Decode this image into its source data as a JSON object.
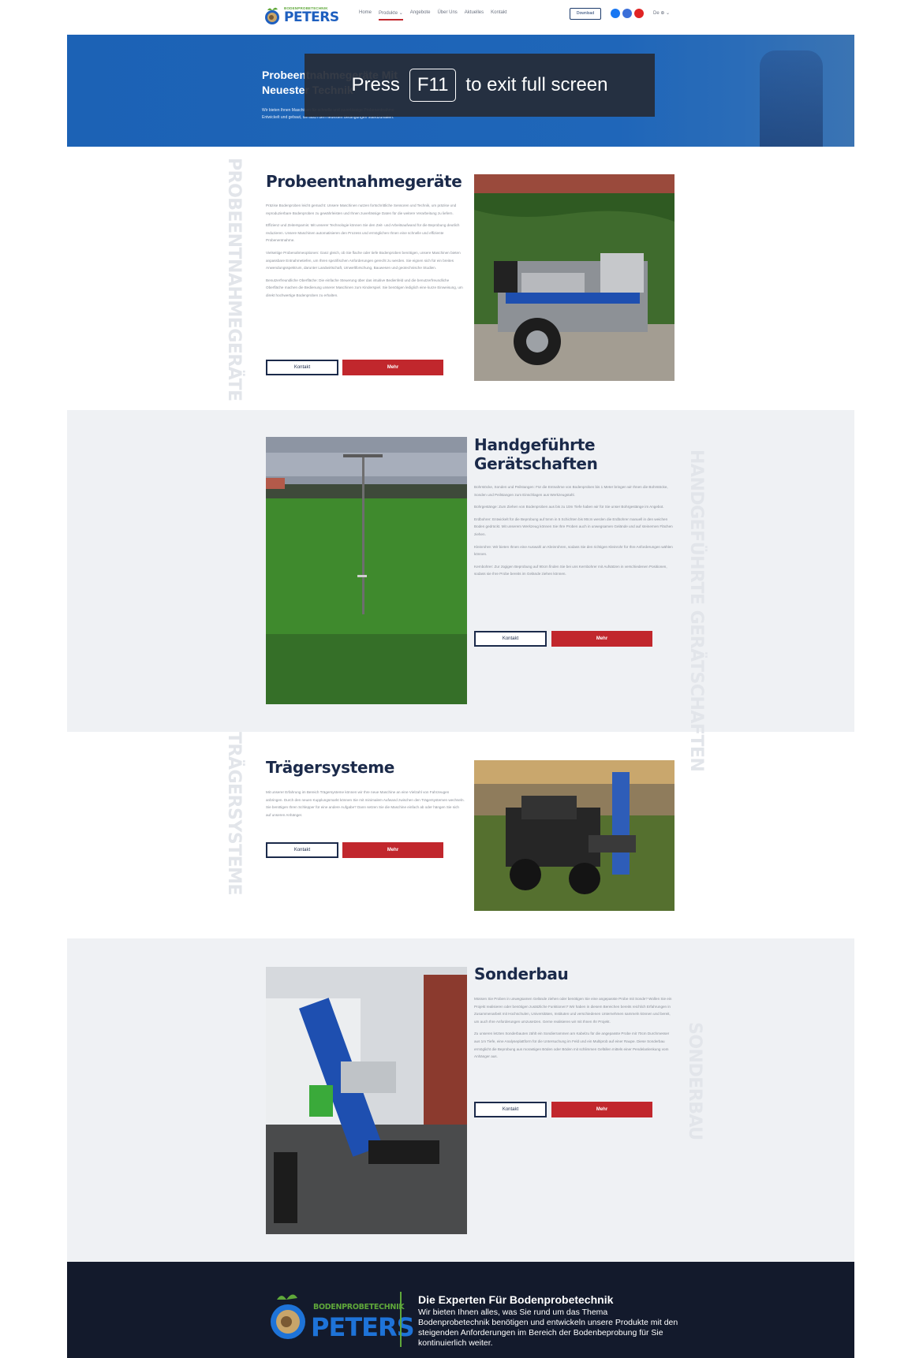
{
  "header": {
    "brand_small": "BODENPROBETECHNIK",
    "brand_big": "PETERS",
    "nav": [
      "Home",
      "Produkte ⌄",
      "Angebote",
      "Über Uns",
      "Aktuelles",
      "Kontakt"
    ],
    "download_label": "Download",
    "language": "De ⊕ ⌄"
  },
  "hero": {
    "title_line1": "Probeentnahmegeräte Mit",
    "title_line2": "Neuester Technik",
    "subtitle_line1": "Wir bieten Ihnen Maschinen für schnelle und zuverlässige Probenentnahme",
    "subtitle_line2": "Entwickelt und gebaut, um auch den neuesten Bedingungen standzuhalten.",
    "overlay_press": "Press",
    "overlay_key": "F11",
    "overlay_rest": "to exit full screen"
  },
  "sections": [
    {
      "vertical_label": "PROBEENTNAHMEGERÄTE",
      "title": "Probeentnahmegeräte",
      "paragraphs": [
        "Präzise Bodenproben leicht gemacht: Unsere Maschinen nutzen fortschrittliche Sensoren und Technik, um präzise und reproduzierbare Bodenproben zu gewährleisten und Ihnen zuverlässige Daten für die weitere Verarbeitung zu liefern.",
        "Effizienz und Zeitersparnis: Mit unserer Technologie können Sie den Zeit- und Arbeitsaufwand für die Beprobung deutlich reduzieren. Unsere Maschinen automatisieren den Prozess und ermöglichen Ihnen eine schnelle und effiziente Probenentnahme.",
        "Vielseitige Probenahmeoptionen: Ganz gleich, ob Sie flache oder tiefe Bodenproben benötigen, unsere Maschinen bieten anpassbare Entnahmetiefen, um Ihren spezifischen Anforderungen gerecht zu werden. Sie eignen sich für ein breites Anwendungsspektrum, darunter Landwirtschaft, Umweltforschung, Bauwesen und geotechnische Studien.",
        "Benutzerfreundliche Oberfläche: Die einfache Steuerung über das intuitive Bedienfeld und die benutzerfreundliche Oberfläche machen die Bedienung unserer Maschinen zum Kinderspiel. Sie benötigen lediglich eine kurze Einweisung, um direkt hochwertige Bodenproben zu erhalten."
      ],
      "btn_contact": "Kontakt",
      "btn_more": "Mehr"
    },
    {
      "vertical_label": "HANDGEFÜHRTE GERÄTSCHAFTEN",
      "title_line1": "Handgeführte",
      "title_line2": "Gerätschaften",
      "paragraphs": [
        "Bohrstöcke, Sonden und Peilstangen: Für die Entnahme von Bodenproben bis 1 Meter bringen wir Ihnen die Bohrstöcke, Sonden und Peilstangen zum Einschlagen aus Werkzeugstahl.",
        "Bohrgestänge: Zum Ziehen von Bodenproben aus bis zu 10m Tiefe haben wir für Sie unser Bohrgestänge im Angebot.",
        "Erdbohrer: Entwickelt für die Beprobung auf 5mm in 5 Schichten bis 90cm werden die Erdbohrer manuell in den weichen Boden gedrückt. Mit unserem Werkzeug können Sie Ihre Proben auch in unwegsamen Gelände und auf steinernen Flächen ziehen.",
        "Kleinrohre: Wir bieten Ihnen eine Auswahl an Kleinrohren, sodass Sie den richtigen Kleinrohr für Ihre Anforderungen wählen können.",
        "Kernbohrer: Zur zügigen Beprobung auf 90cm finden Sie bei uns Kernbohrer mit Aufsätzen in verschiedenen Positionen, sodass sie Ihre Probe bereits im Gelände ziehen können."
      ],
      "btn_contact": "Kontakt",
      "btn_more": "Mehr"
    },
    {
      "vertical_label": "TRÄGERSYSTEME",
      "title": "Trägersysteme",
      "paragraphs": [
        "Mit unserer Erfahrung im Bereich Trägersysteme können wir Ihre neue Maschine an eine Vielzahl von Fahrzeugen anbringen. Durch den neuen Kupplungsmarkt können Sie mit minimalem Aufwand zwischen den Trägersystemen wechseln. Sie benötigen Ihren Schlepper für eine andere Aufgabe? Dann setzen Sie die Maschine einfach ab oder hängen Sie sich auf unseren Anhänger."
      ],
      "btn_contact": "Kontakt",
      "btn_more": "Mehr"
    },
    {
      "vertical_label": "SONDERBAU",
      "title": "Sonderbau",
      "paragraphs": [
        "Müssen Sie Proben in unwegsamen Gelände ziehen oder benötigen Sie eine angepasste Probe mit Sonde? Wollen Sie ein Projekt realisieren oder benötigen zusätzliche Funktionen? Wir haben in diesem Bereichen bereits reichlich Erfahrungen in Zusammenarbeit mit Hochschulen, Universitäten, Instituten und verschiedenen Unternehmen sammeln können und bereit, um auch Ihre Anforderungen umzusetzen. Gerne realisieren wir mit Ihnen Ihr Projekt.",
        "Zu unseren letzten Sonderbauten zählt ein Sondierrammen am Kabelzu für die angepasste Probe mit 70cm Durchmesser aus 1m Tiefe, eine Analyseplattform für die Untersuchung im Feld und ein Multiprob auf einer Raupe. Diese Sonderbau ermöglicht die Beprobung aus morastigen Böden oder Böden mit schlimmen Gefällen mittels einer Pendelanlenkung vom Anhänger aus."
      ],
      "btn_contact": "Kontakt",
      "btn_more": "Mehr"
    }
  ],
  "footer": {
    "brand_small": "BODENPROBETECHNIK",
    "brand_big": "PETERS",
    "title": "Die Experten Für Bodenprobetechnik",
    "text": "Wir bieten Ihnen alles, was Sie rund um das Thema Bodenprobetechnik benötigen und entwickeln unsere Produkte mit den steigenden Anforderungen im Bereich der Bodenbeprobung für Sie kontinuierlich weiter."
  },
  "colors": {
    "brand_blue": "#1e5fbf",
    "brand_green": "#5fa83a",
    "accent_red": "#c1272d",
    "navy": "#1b2a4a",
    "footer_bg": "#131a2c"
  }
}
